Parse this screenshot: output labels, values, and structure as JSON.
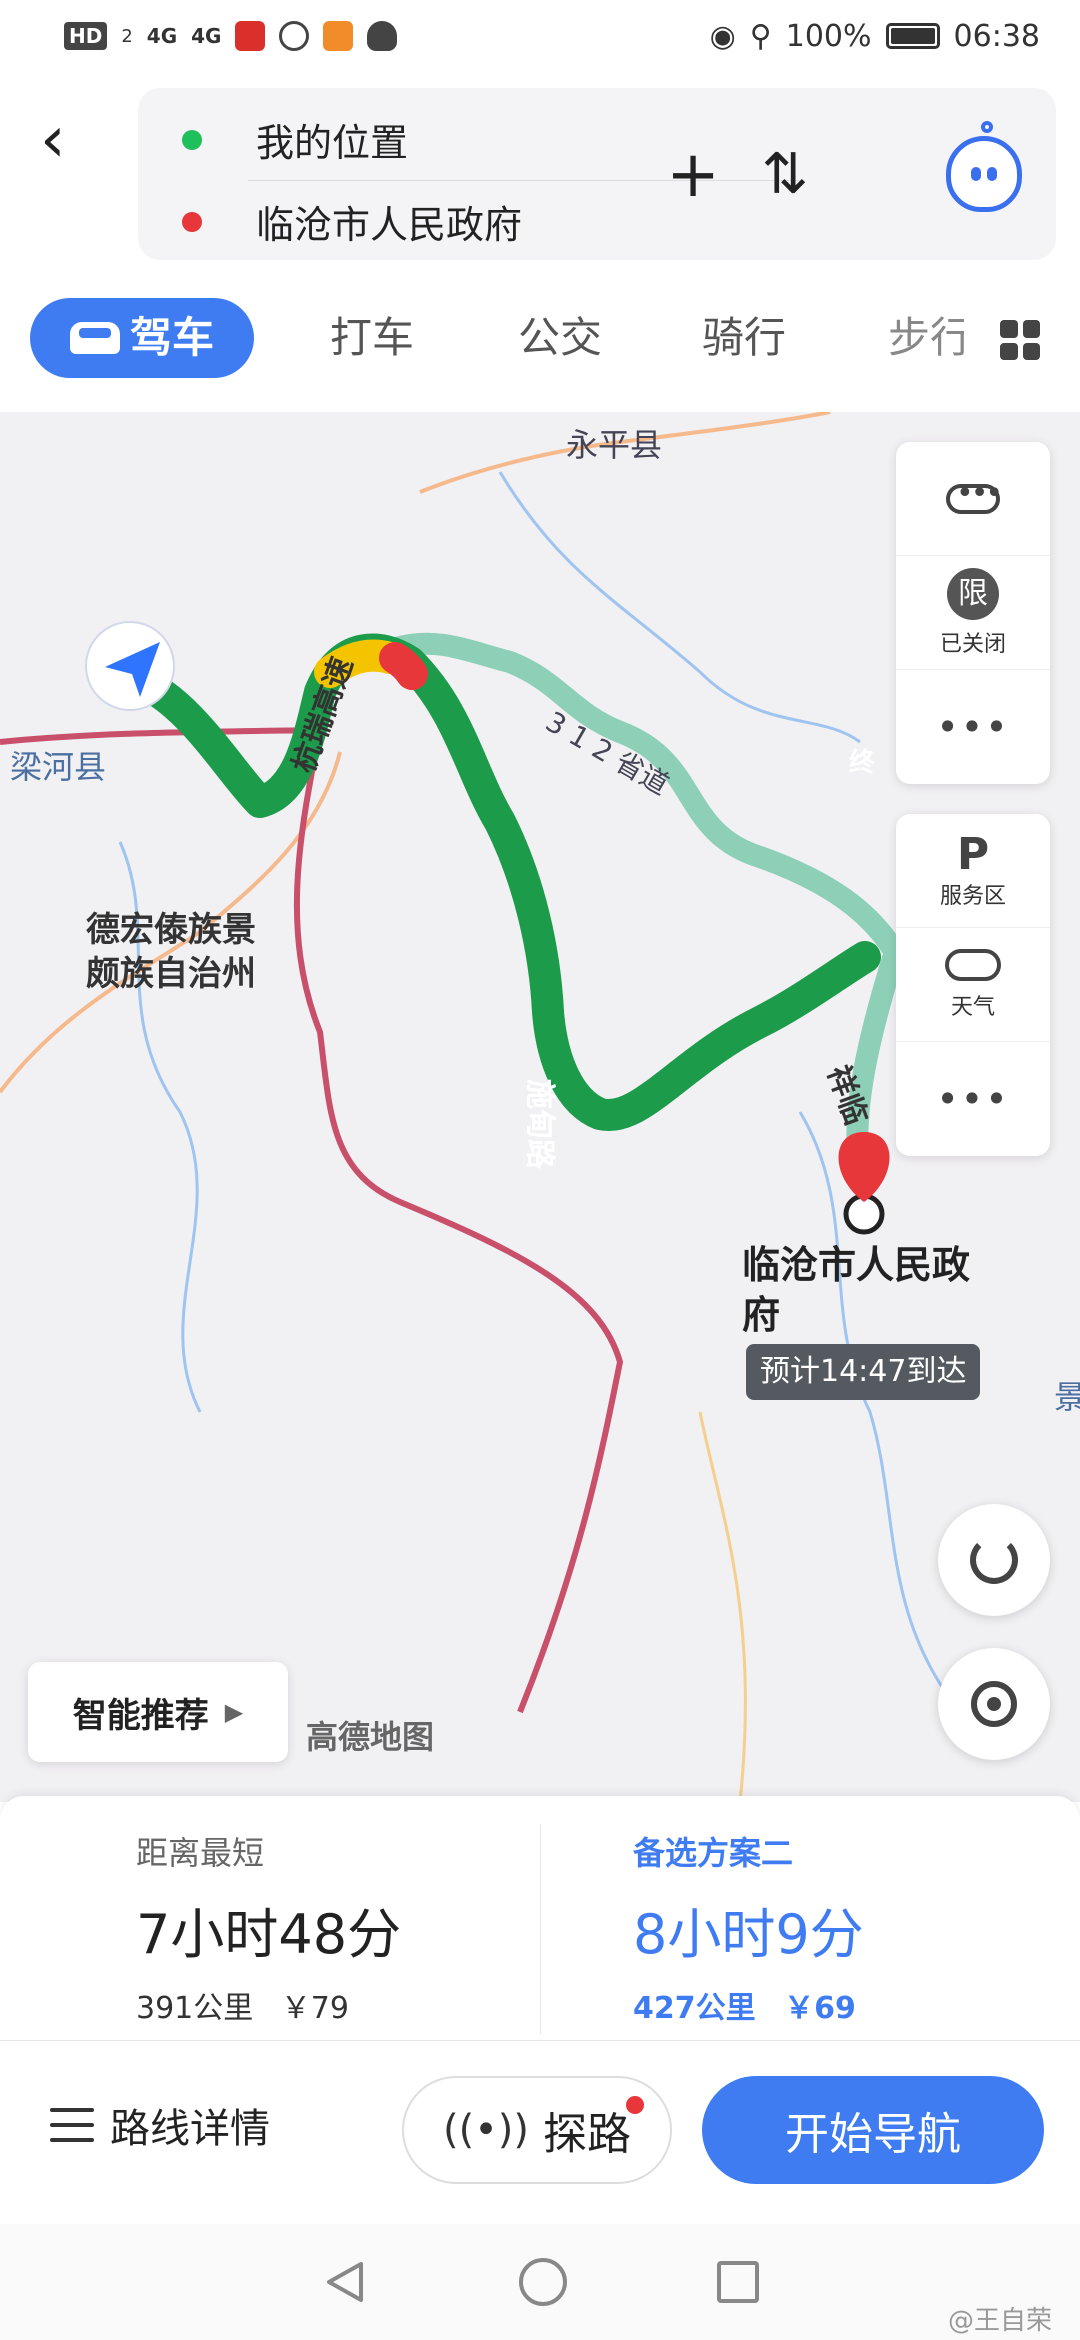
{
  "status_bar": {
    "left_badges": [
      "HD",
      "2",
      "4G",
      "4G"
    ],
    "battery": "100%",
    "time": "06:38",
    "icons": [
      "hd-icon",
      "signal-icon",
      "mic-icon",
      "weibo-icon",
      "app-icon",
      "qq-icon",
      "eye-icon",
      "location-icon",
      "battery-icon"
    ]
  },
  "route": {
    "origin": "我的位置",
    "destination": "临沧市人民政府"
  },
  "header": {
    "add_label": "+",
    "swap_label": "⇅"
  },
  "modes": [
    "驾车",
    "打车",
    "公交",
    "骑行",
    "步行"
  ],
  "map": {
    "places": [
      "永平县",
      "梁河县",
      "德宏傣族景",
      "颇族自治州",
      "景"
    ],
    "roads": [
      "杭瑞高速",
      "3 1 2 省道",
      "施甸路",
      "祥临"
    ],
    "dest_marker": "终",
    "dest_label": "临沧市人民政府",
    "eta": "预计14:47到达",
    "panel_top": {
      "limit_glyph": "限",
      "limit_label": "已关闭",
      "more": "•••"
    },
    "panel_bottom": {
      "service_glyph": "P",
      "service_label": "服务区",
      "weather_label": "天气",
      "more": "•••"
    },
    "smart_label": "智能推荐",
    "logo": "高德地图"
  },
  "plans": [
    {
      "label": "距离最短",
      "time": "7小时48分",
      "distance": "391公里",
      "toll": "￥79"
    },
    {
      "label": "备选方案二",
      "time": "8小时9分",
      "distance": "427公里",
      "toll": "￥69"
    }
  ],
  "actions": {
    "details": "路线详情",
    "probe": "探路",
    "start": "开始导航"
  },
  "watermark": "@王自荣",
  "colors": {
    "accent": "#3f7cf2",
    "route_main": "#1c9b4a",
    "route_alt": "#8ecfb8",
    "border": "#c8506a",
    "destination": "#e8373a"
  }
}
